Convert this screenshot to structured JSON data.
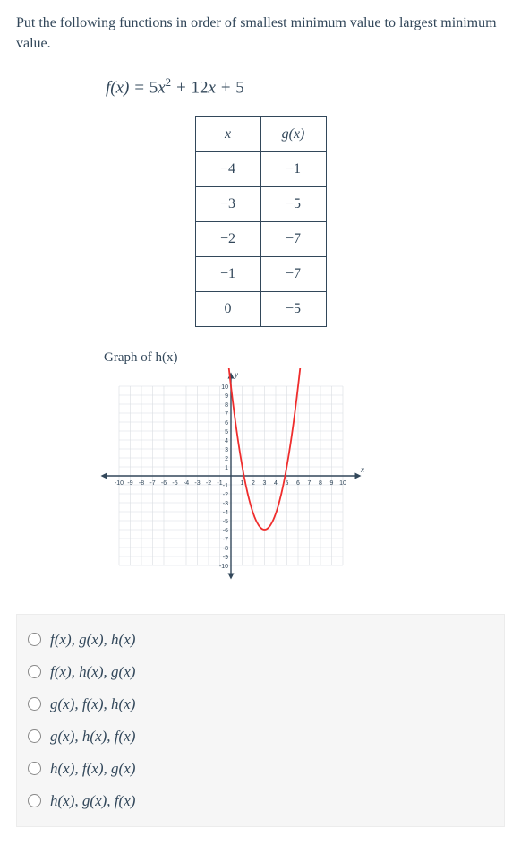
{
  "question": "Put the following functions in order of smallest minimum value to largest minimum value.",
  "formula_html": "<span class='fn'>f</span>(<span class='fn'>x</span>) = <span class='num'>5</span><span class='fn'>x</span><sup>2</sup> + <span class='num'>12</span><span class='fn'>x</span> + <span class='num'>5</span>",
  "table": {
    "head": [
      "x",
      "g(x)"
    ],
    "rows": [
      [
        "−4",
        "−1"
      ],
      [
        "−3",
        "−5"
      ],
      [
        "−2",
        "−7"
      ],
      [
        "−1",
        "−7"
      ],
      [
        "0",
        "−5"
      ]
    ]
  },
  "graph_label": "Graph of h(x)",
  "chart_data": {
    "type": "line",
    "title": "Graph of h(x)",
    "xlabel": "x",
    "ylabel": "y",
    "xlim": [
      -10,
      10
    ],
    "ylim": [
      -10,
      10
    ],
    "series": [
      {
        "name": "h(x)",
        "x": [
          0,
          1,
          2,
          3,
          4,
          5,
          6,
          7
        ],
        "y": [
          10,
          2,
          -4,
          -6,
          -4,
          2,
          10,
          10
        ],
        "color": "#ef2d2d",
        "vertex": [
          3,
          -6
        ]
      }
    ],
    "grid": true,
    "axis_ticks": [
      -10,
      -9,
      -8,
      -7,
      -6,
      -5,
      -4,
      -3,
      -2,
      -1,
      1,
      2,
      3,
      4,
      5,
      6,
      7,
      8,
      9,
      10
    ]
  },
  "options": [
    "f(x),  g(x),  h(x)",
    "f(x),  h(x),  g(x)",
    "g(x),  f(x),  h(x)",
    "g(x),  h(x),  f(x)",
    "h(x),  f(x),  g(x)",
    "h(x),  g(x),  f(x)"
  ]
}
